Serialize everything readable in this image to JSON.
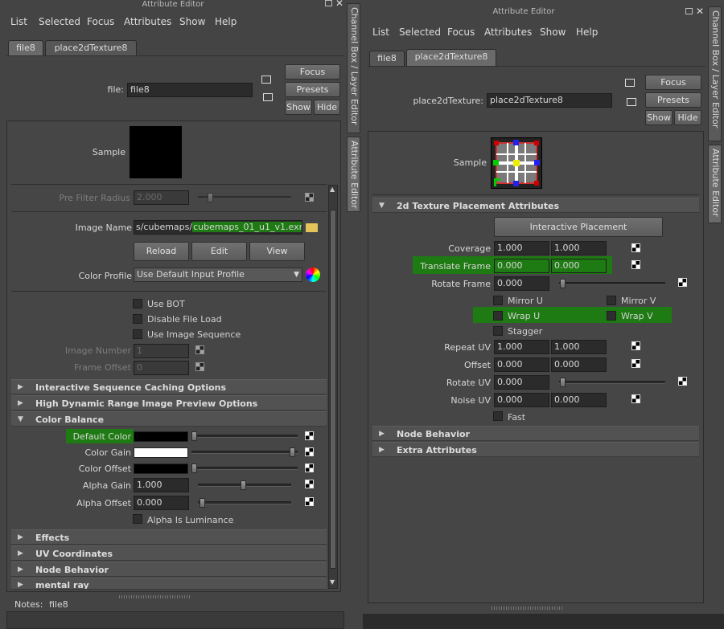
{
  "left": {
    "title": "Attribute Editor",
    "menu": [
      "List",
      "Selected",
      "Focus",
      "Attributes",
      "Show",
      "Help"
    ],
    "tabs": [
      "file8",
      "place2dTexture8"
    ],
    "node_label": "file:",
    "node_value": "file8",
    "buttons": {
      "focus": "Focus",
      "presets": "Presets",
      "show": "Show",
      "hide": "Hide"
    },
    "sample_label": "Sample",
    "pre_filter_label": "Pre Filter Radius",
    "pre_filter_value": "2.000",
    "image_name_label": "Image Name",
    "image_name_prefix": "s/cubemaps/",
    "image_name_file": "cubemaps_01_u1_v1.exr",
    "reload": "Reload",
    "edit": "Edit",
    "view": "View",
    "color_profile_label": "Color Profile",
    "color_profile_value": "Use Default Input Profile",
    "use_bot": "Use BOT",
    "disable_file_load": "Disable File Load",
    "use_image_sequence": "Use Image Sequence",
    "image_number_label": "Image Number",
    "image_number_value": "1",
    "frame_offset_label": "Frame Offset",
    "frame_offset_value": "0",
    "sections": [
      "Interactive Sequence Caching Options",
      "High Dynamic Range Image Preview Options",
      "Color Balance"
    ],
    "default_color": "Default Color",
    "color_gain": "Color Gain",
    "color_offset": "Color Offset",
    "alpha_gain_label": "Alpha Gain",
    "alpha_gain_value": "1.000",
    "alpha_offset_label": "Alpha Offset",
    "alpha_offset_value": "0.000",
    "alpha_is_luminance": "Alpha Is Luminance",
    "lower_sections": [
      "Effects",
      "UV Coordinates",
      "Node Behavior",
      "mental ray"
    ],
    "notes_label": "Notes:",
    "notes_value": "file8",
    "colors": {
      "default_color": "#000000",
      "color_gain": "#ffffff",
      "color_offset": "#000000"
    }
  },
  "side_tabs": {
    "channel_box": "Channel Box / Layer Editor",
    "attribute_editor": "Attribute Editor"
  },
  "right": {
    "title": "Attribute Editor",
    "menu": [
      "List",
      "Selected",
      "Focus",
      "Attributes",
      "Show",
      "Help"
    ],
    "tabs": [
      "file8",
      "place2dTexture8"
    ],
    "node_label": "place2dTexture:",
    "node_value": "place2dTexture8",
    "buttons": {
      "focus": "Focus",
      "presets": "Presets",
      "show": "Show",
      "hide": "Hide"
    },
    "sample_label": "Sample",
    "section_title": "2d Texture Placement Attributes",
    "interactive_placement": "Interactive Placement",
    "coverage_label": "Coverage",
    "coverage": [
      "1.000",
      "1.000"
    ],
    "translate_frame_label": "Translate Frame",
    "translate_frame": [
      "0.000",
      "0.000"
    ],
    "rotate_frame_label": "Rotate Frame",
    "rotate_frame": "0.000",
    "mirror_u": "Mirror U",
    "mirror_v": "Mirror V",
    "wrap_u": "Wrap U",
    "wrap_v": "Wrap V",
    "stagger": "Stagger",
    "repeat_uv_label": "Repeat UV",
    "repeat_uv": [
      "1.000",
      "1.000"
    ],
    "offset_label": "Offset",
    "offset": [
      "0.000",
      "0.000"
    ],
    "rotate_uv_label": "Rotate UV",
    "rotate_uv": "0.000",
    "noise_uv_label": "Noise UV",
    "noise_uv": [
      "0.000",
      "0.000"
    ],
    "fast": "Fast",
    "lower_sections": [
      "Node Behavior",
      "Extra Attributes"
    ]
  },
  "highlight_color": "#1e7a12"
}
